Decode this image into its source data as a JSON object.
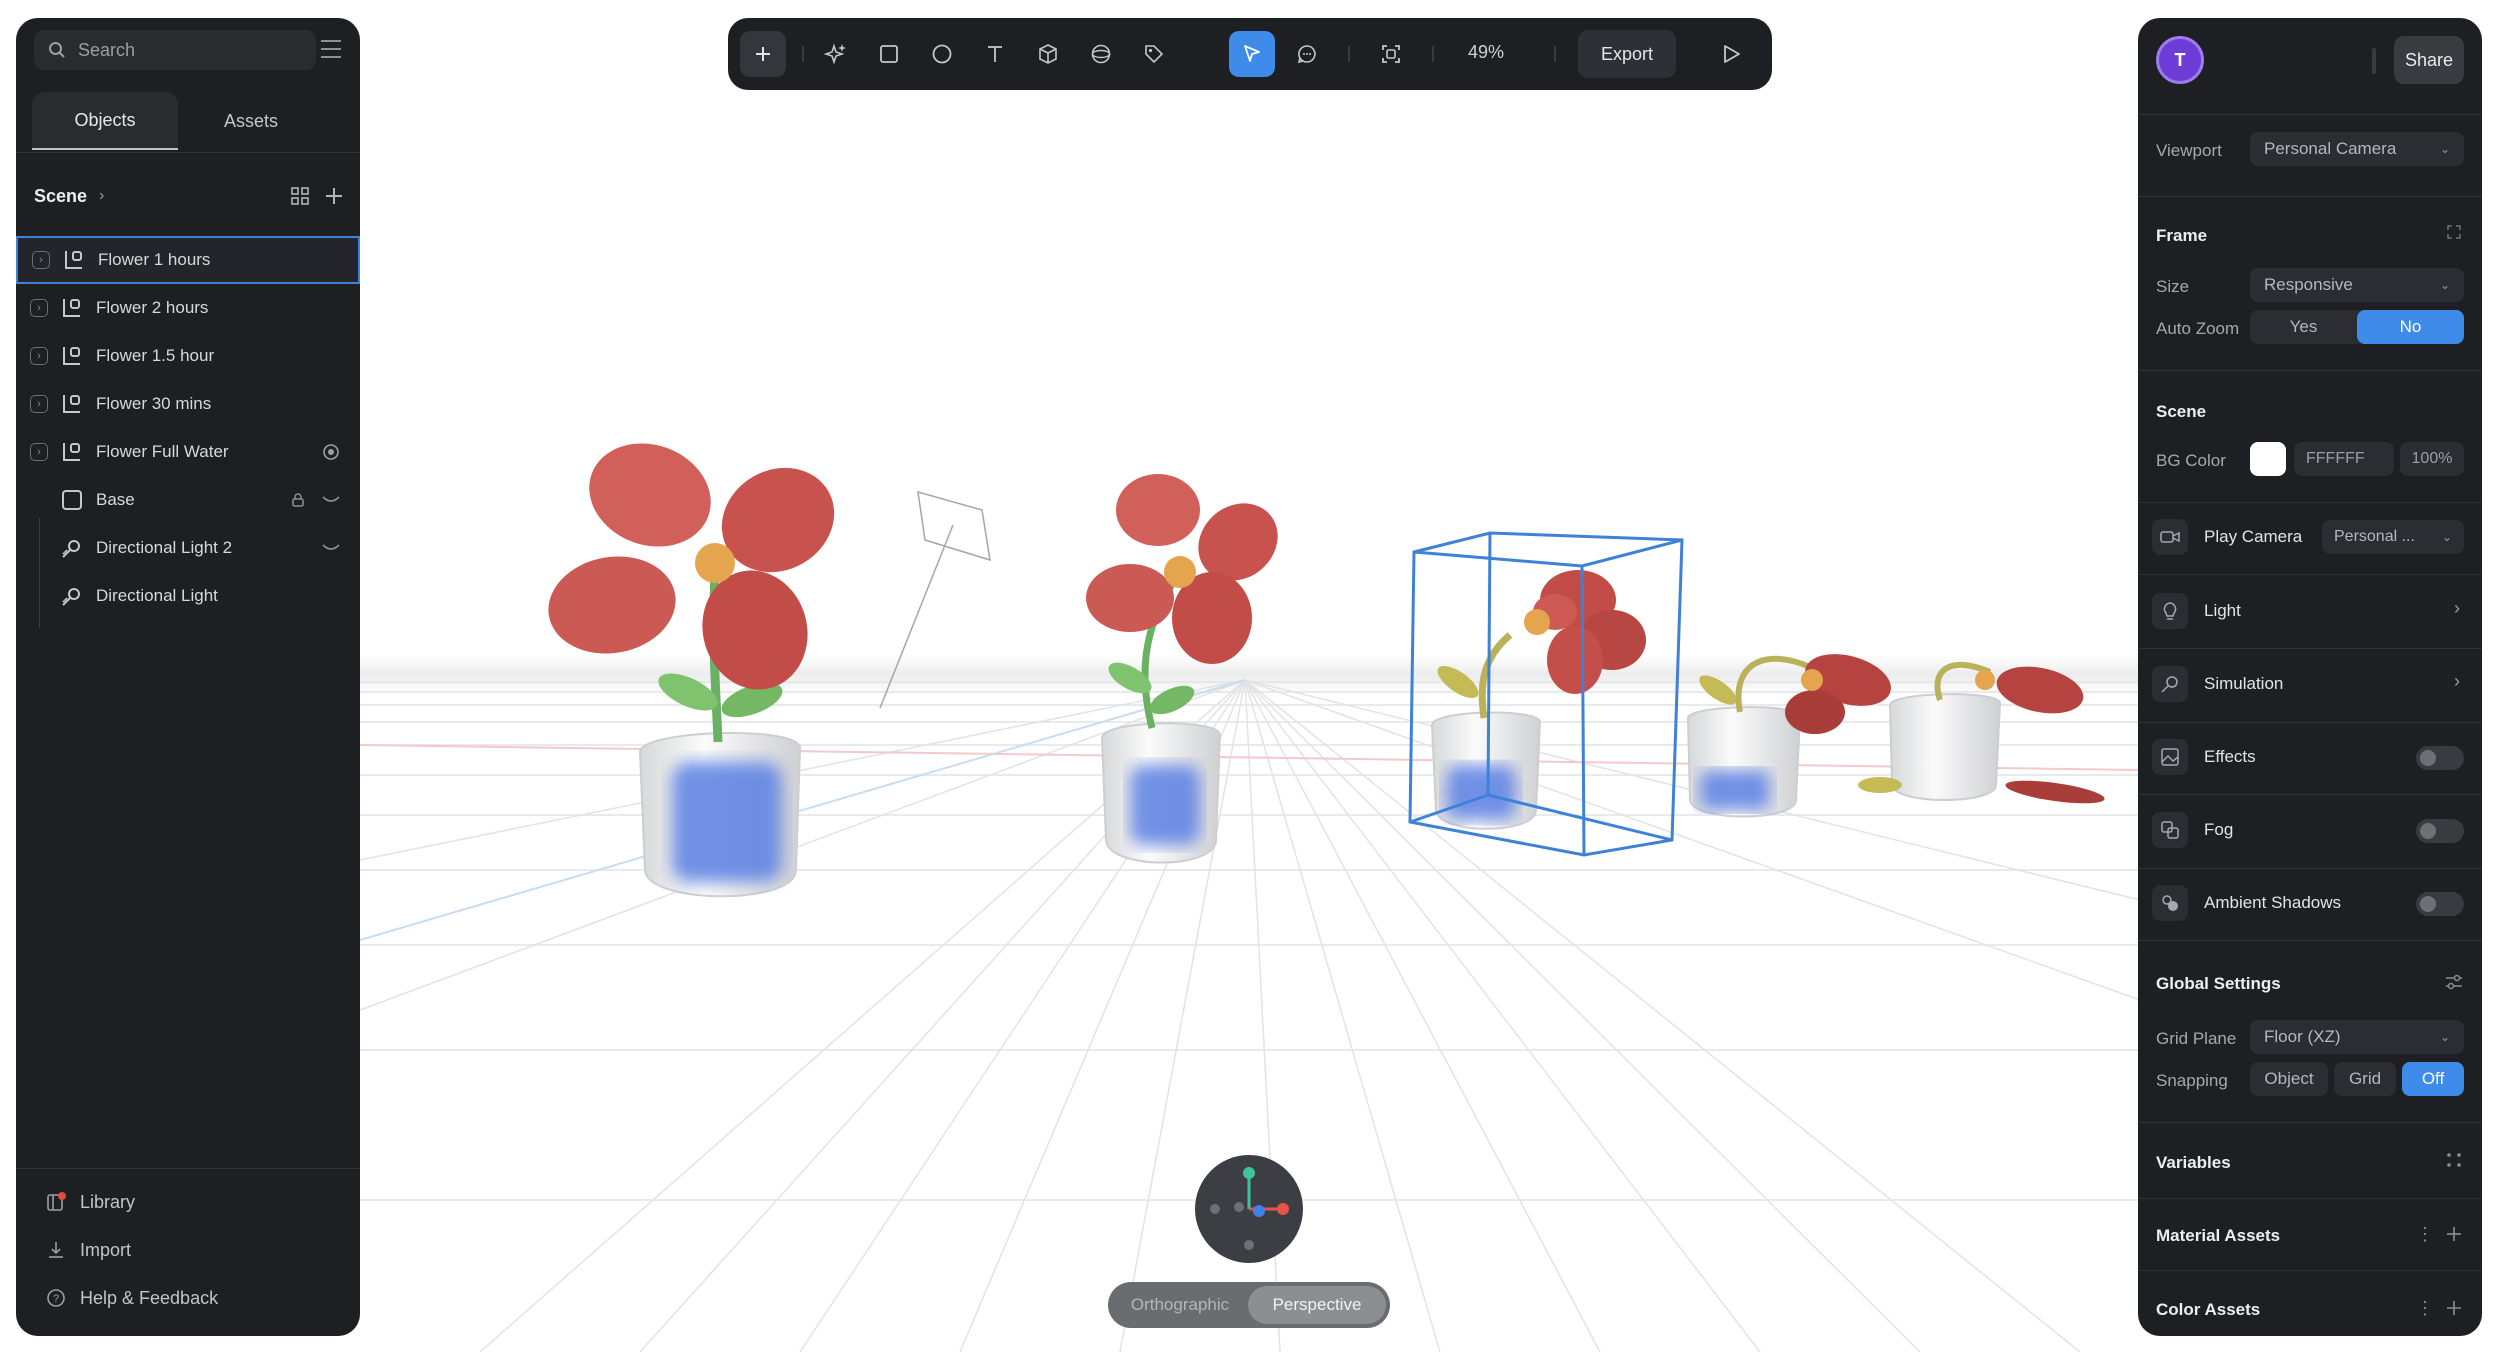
{
  "left_panel": {
    "search_placeholder": "Search",
    "tabs": [
      {
        "label": "Objects"
      },
      {
        "label": "Assets"
      }
    ],
    "scene_title": "Scene",
    "layers": [
      {
        "name": "Flower 1 hours"
      },
      {
        "name": "Flower 2 hours"
      },
      {
        "name": "Flower 1.5 hour"
      },
      {
        "name": "Flower 30 mins"
      },
      {
        "name": "Flower Full Water"
      },
      {
        "name": "Base"
      },
      {
        "name": "Directional Light 2"
      },
      {
        "name": "Directional Light"
      }
    ],
    "bottom_links": [
      {
        "label": "Library"
      },
      {
        "label": "Import"
      },
      {
        "label": "Help & Feedback"
      }
    ]
  },
  "toolbar": {
    "zoom": "49%",
    "export_label": "Export",
    "tools": [
      "plus-icon",
      "ai-sparkle-icon",
      "rectangle-icon",
      "ellipse-icon",
      "text-icon",
      "cube-icon",
      "sphere-icon",
      "tag-icon",
      "select-cursor-icon",
      "comment-icon",
      "frame-fit-icon",
      "play-icon"
    ]
  },
  "camera_switch": {
    "options": [
      {
        "label": "Orthographic"
      },
      {
        "label": "Perspective"
      }
    ],
    "selected": "Perspective"
  },
  "right_panel": {
    "avatar_letter": "T",
    "share_label": "Share",
    "viewport_label": "Viewport",
    "viewport_value": "Personal Camera",
    "frame": {
      "title": "Frame",
      "size_label": "Size",
      "size_value": "Responsive",
      "auto_zoom_label": "Auto Zoom",
      "auto_zoom_yes": "Yes",
      "auto_zoom_no": "No",
      "auto_zoom_selected": "No"
    },
    "scene": {
      "title": "Scene",
      "bg_color_label": "BG Color",
      "bg_hex": "FFFFFF",
      "bg_opacity": "100%",
      "play_camera_label": "Play Camera",
      "play_camera_value": "Personal ...",
      "light_label": "Light",
      "simulation_label": "Simulation",
      "effects_label": "Effects",
      "fog_label": "Fog",
      "ambient_label": "Ambient Shadows"
    },
    "global": {
      "title": "Global Settings",
      "grid_plane_label": "Grid Plane",
      "grid_plane_value": "Floor (XZ)",
      "snapping_label": "Snapping",
      "snap_object": "Object",
      "snap_grid": "Grid",
      "snap_off": "Off",
      "snap_selected": "Off"
    },
    "variables_title": "Variables",
    "material_assets_title": "Material Assets",
    "color_assets_title": "Color Assets"
  },
  "colors": {
    "panel_bg": "#1e1f22",
    "accent_blue": "#3f8be9",
    "petal_red": "#c94f4a",
    "selection_blue": "#3e82d8"
  }
}
